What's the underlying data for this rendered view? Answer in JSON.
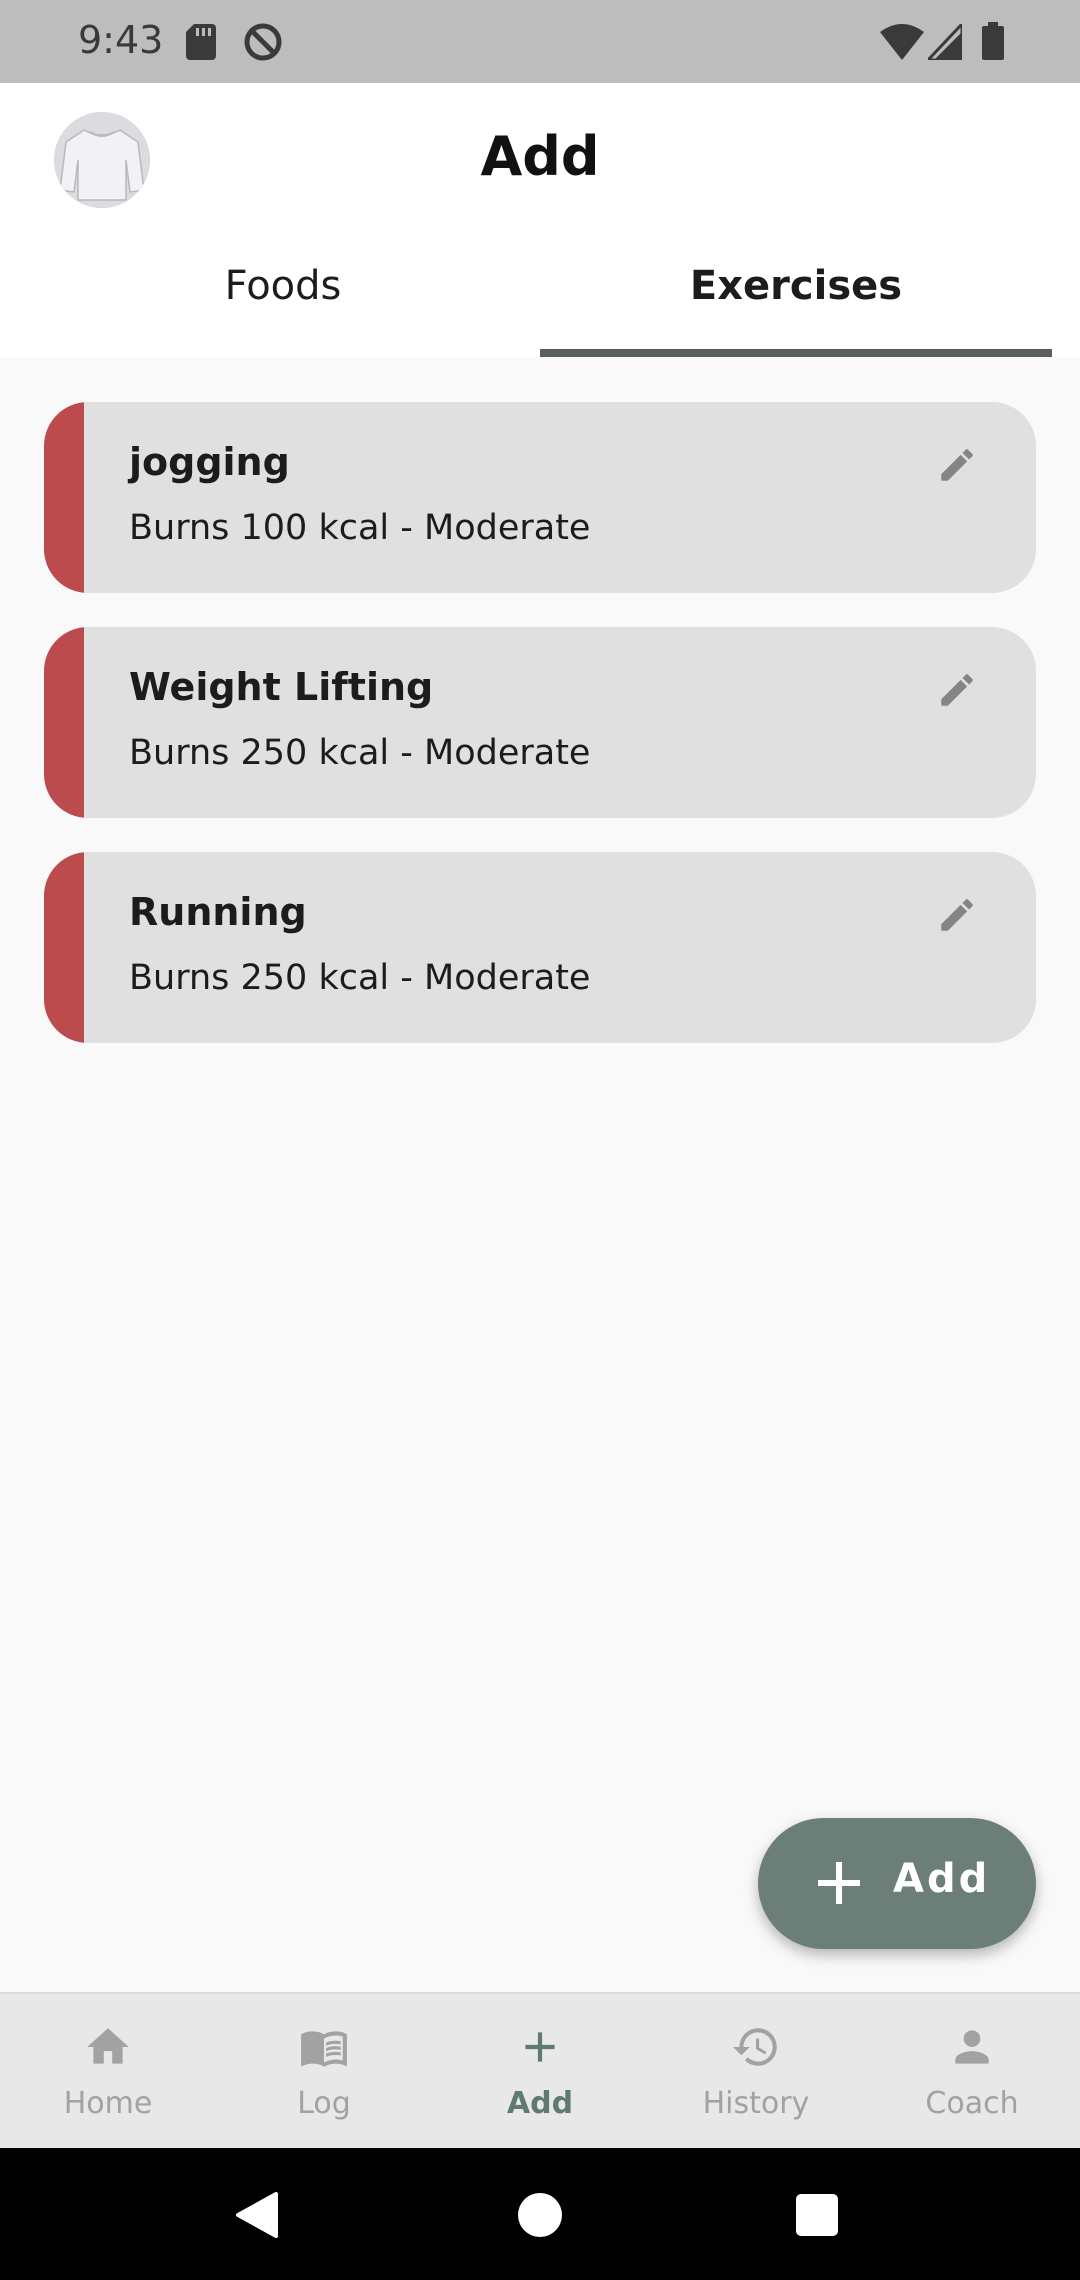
{
  "status_bar": {
    "time": "9:43"
  },
  "header": {
    "title": "Add"
  },
  "tabs": [
    {
      "label": "Foods",
      "selected": false
    },
    {
      "label": "Exercises",
      "selected": true
    }
  ],
  "exercises": [
    {
      "name": "jogging",
      "detail": "Burns 100 kcal  -  Moderate"
    },
    {
      "name": "Weight Lifting",
      "detail": "Burns 250 kcal  -  Moderate"
    },
    {
      "name": "Running",
      "detail": "Burns 250 kcal  -  Moderate"
    }
  ],
  "fab": {
    "label": "Add",
    "icon": "plus-icon"
  },
  "bottom_nav": {
    "items": [
      {
        "label": "Home",
        "icon": "home-icon"
      },
      {
        "label": "Log",
        "icon": "book-icon"
      },
      {
        "label": "Add",
        "icon": "plus-icon",
        "active": true
      },
      {
        "label": "History",
        "icon": "history-icon"
      },
      {
        "label": "Coach",
        "icon": "person-icon"
      }
    ]
  },
  "colors": {
    "accent_bar": "#bc4b4e",
    "fab": "#6b7e78",
    "nav_active": "#5f7a72",
    "card": "#e0e0e0"
  }
}
